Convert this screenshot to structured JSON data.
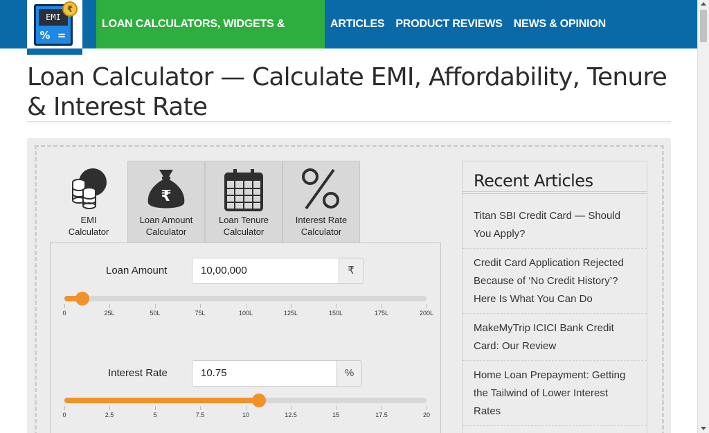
{
  "header": {
    "logo_text": "EMI",
    "logo_key_percent": "%",
    "logo_key_equals": "=",
    "logo_coin": "₹",
    "nav": [
      {
        "label": "LOAN CALCULATORS, WIDGETS & RATES",
        "active": true
      },
      {
        "label": "ARTICLES"
      },
      {
        "label": "PRODUCT REVIEWS"
      },
      {
        "label": "NEWS & OPINION"
      }
    ],
    "colors": {
      "bar": "#0a6aa8",
      "active": "#2eae3f"
    }
  },
  "page": {
    "title": "Loan Calculator — Calculate EMI, Affordability, Tenure & Interest Rate"
  },
  "tabs": [
    {
      "label_line1": "EMI",
      "label_line2": "Calculator",
      "icon": "coins-icon",
      "active": true
    },
    {
      "label_line1": "Loan Amount",
      "label_line2": "Calculator",
      "icon": "money-bag-icon"
    },
    {
      "label_line1": "Loan Tenure",
      "label_line2": "Calculator",
      "icon": "calendar-icon"
    },
    {
      "label_line1": "Interest Rate",
      "label_line2": "Calculator",
      "icon": "percent-icon"
    }
  ],
  "form": {
    "loan_amount": {
      "label": "Loan Amount",
      "value": "10,00,000",
      "unit": "₹",
      "slider_fraction": 0.05,
      "ticks": [
        "0",
        "25L",
        "50L",
        "75L",
        "100L",
        "125L",
        "150L",
        "175L",
        "200L"
      ]
    },
    "interest_rate": {
      "label": "Interest Rate",
      "value": "10.75",
      "unit": "%",
      "slider_fraction": 0.5375,
      "ticks": [
        "0",
        "2.5",
        "5",
        "7.5",
        "10",
        "12.5",
        "15",
        "17.5",
        "20"
      ]
    },
    "accent_color": "#f0922a"
  },
  "sidebar": {
    "title": "Recent Articles",
    "articles": [
      {
        "line1": "Titan SBI Credit Card — Should",
        "line2": "You Apply?"
      },
      {
        "line1": "Credit Card Application Rejected",
        "line2": "Because of ‘No Credit History’?",
        "line3": "Here Is What You Can Do"
      },
      {
        "line1": "MakeMyTrip ICICI Bank Credit",
        "line2": "Card: Our Review"
      },
      {
        "line1": "Home Loan Prepayment: Getting",
        "line2": "the Tailwind of Lower Interest",
        "line3": "Rates"
      }
    ]
  }
}
